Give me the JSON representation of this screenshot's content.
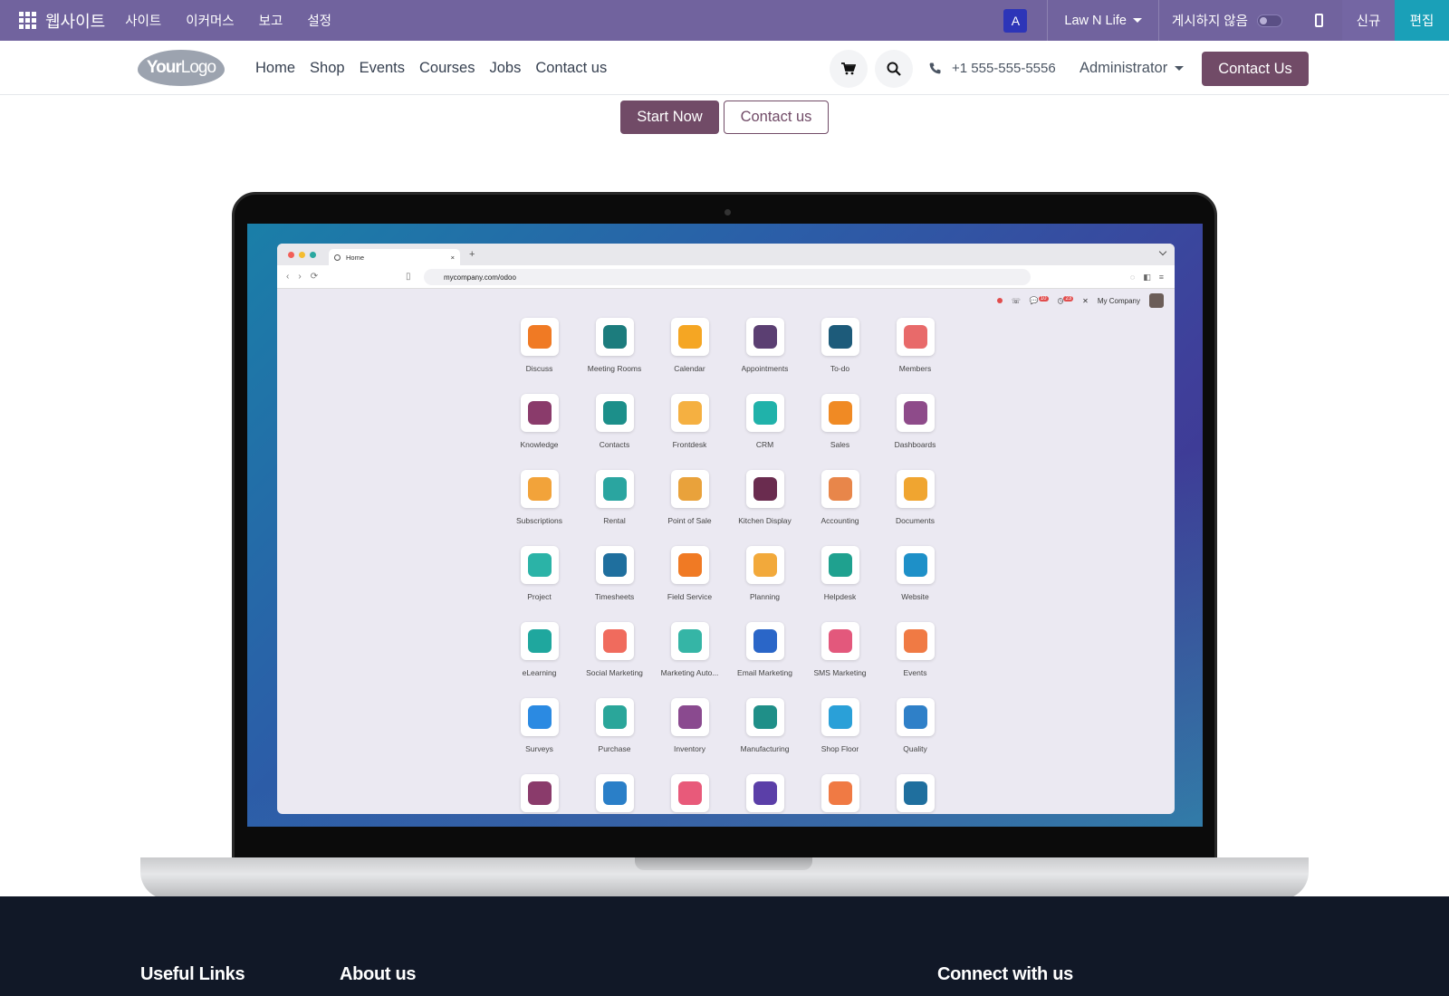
{
  "adminbar": {
    "brand": "웹사이트",
    "menus": [
      "사이트",
      "이커머스",
      "보고",
      "설정"
    ],
    "avatar_letter": "A",
    "website": "Law N Life",
    "publish_label": "게시하지 않음",
    "new_label": "신규",
    "edit_label": "편집"
  },
  "header": {
    "logo_bold": "Your",
    "logo_light": "Logo",
    "nav": [
      "Home",
      "Shop",
      "Events",
      "Courses",
      "Jobs",
      "Contact us"
    ],
    "phone": "+1 555-555-5556",
    "user": "Administrator",
    "cta": "Contact Us"
  },
  "hero": {
    "primary": "Start Now",
    "secondary": "Contact us"
  },
  "browser": {
    "tab_title": "Home",
    "url": "mycompany.com/odoo",
    "company": "My Company",
    "badge_1": "10",
    "badge_2": "23"
  },
  "apps": [
    {
      "label": "Discuss",
      "color": "#f07a24"
    },
    {
      "label": "Meeting Rooms",
      "color": "#1c7c7d"
    },
    {
      "label": "Calendar",
      "color": "#f5a623"
    },
    {
      "label": "Appointments",
      "color": "#5b3f72"
    },
    {
      "label": "To-do",
      "color": "#1d5b7a"
    },
    {
      "label": "Members",
      "color": "#e86a6a"
    },
    {
      "label": "Knowledge",
      "color": "#8a3b6b"
    },
    {
      "label": "Contacts",
      "color": "#1c8f8a"
    },
    {
      "label": "Frontdesk",
      "color": "#f5b041"
    },
    {
      "label": "CRM",
      "color": "#20b2aa"
    },
    {
      "label": "Sales",
      "color": "#f08a24"
    },
    {
      "label": "Dashboards",
      "color": "#8e4b8a"
    },
    {
      "label": "Subscriptions",
      "color": "#f2a33a"
    },
    {
      "label": "Rental",
      "color": "#2aa5a0"
    },
    {
      "label": "Point of Sale",
      "color": "#e9a23b"
    },
    {
      "label": "Kitchen Display",
      "color": "#6a2c4f"
    },
    {
      "label": "Accounting",
      "color": "#e8864a"
    },
    {
      "label": "Documents",
      "color": "#f0a530"
    },
    {
      "label": "Project",
      "color": "#2bb3a7"
    },
    {
      "label": "Timesheets",
      "color": "#1f6f9e"
    },
    {
      "label": "Field Service",
      "color": "#f07a24"
    },
    {
      "label": "Planning",
      "color": "#f2a93b"
    },
    {
      "label": "Helpdesk",
      "color": "#1fa18f"
    },
    {
      "label": "Website",
      "color": "#1e90c8"
    },
    {
      "label": "eLearning",
      "color": "#1fa79e"
    },
    {
      "label": "Social Marketing",
      "color": "#f06b5d"
    },
    {
      "label": "Marketing Auto...",
      "color": "#35b5a6"
    },
    {
      "label": "Email Marketing",
      "color": "#2a66c8"
    },
    {
      "label": "SMS Marketing",
      "color": "#e3587c"
    },
    {
      "label": "Events",
      "color": "#f07a44"
    },
    {
      "label": "Surveys",
      "color": "#2b8ae2"
    },
    {
      "label": "Purchase",
      "color": "#2aa69a"
    },
    {
      "label": "Inventory",
      "color": "#8a4a8f"
    },
    {
      "label": "Manufacturing",
      "color": "#1f8f88"
    },
    {
      "label": "Shop Floor",
      "color": "#2aa0d8"
    },
    {
      "label": "Quality",
      "color": "#2f80c8"
    },
    {
      "label": "",
      "color": "#8a3b6b"
    },
    {
      "label": "",
      "color": "#2a7fc8"
    },
    {
      "label": "",
      "color": "#e85a7a"
    },
    {
      "label": "",
      "color": "#5b3fa8"
    },
    {
      "label": "",
      "color": "#f07a44"
    },
    {
      "label": "",
      "color": "#1f6f9e"
    }
  ],
  "footer": {
    "col1": "Useful Links",
    "col2": "About us",
    "col3": "Connect with us"
  }
}
